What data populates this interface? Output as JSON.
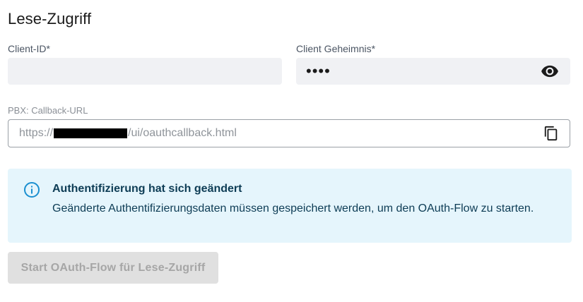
{
  "section": {
    "title": "Lese-Zugriff"
  },
  "client_id": {
    "label": "Client-ID*",
    "value": ""
  },
  "client_secret": {
    "label": "Client Geheimnis*",
    "masked_value": "••••",
    "toggle_icon": "eye-icon"
  },
  "callback": {
    "label": "PBX: Callback-URL",
    "url_prefix": "https://",
    "url_suffix": "/ui/oauthcallback.html",
    "copy_icon": "copy-icon"
  },
  "alert": {
    "icon": "info-icon",
    "title": "Authentifizierung hat sich geändert",
    "message": "Geänderte Authentifizierungsdaten müssen gespeichert werden, um den OAuth-Flow zu starten.",
    "accent": "#1a8fd0",
    "background": "#e5f5fc"
  },
  "start_button": {
    "label": "Start OAuth-Flow für Lese-Zugriff",
    "disabled": true
  }
}
